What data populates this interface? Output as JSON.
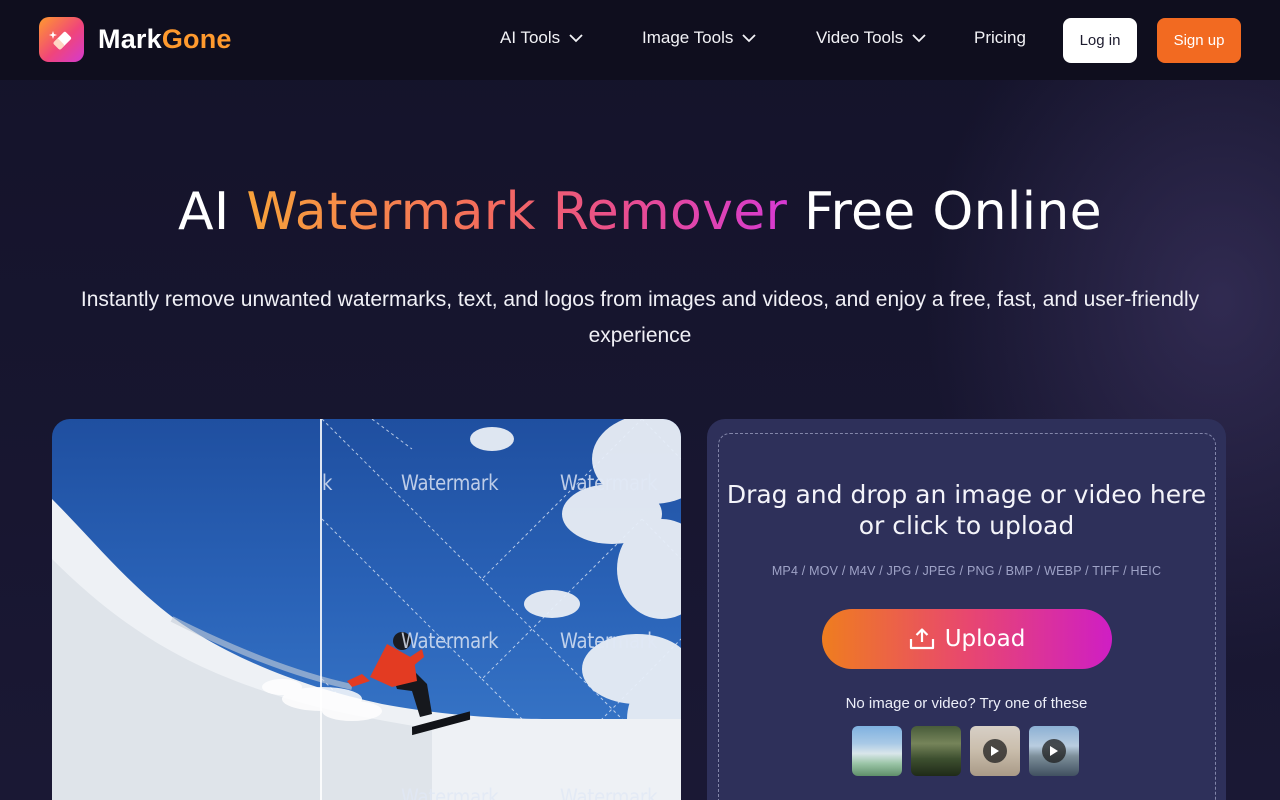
{
  "brand": {
    "name_part1": "Mark",
    "name_part2": "Gone",
    "logo_icon": "eraser-sparkle-icon"
  },
  "nav": {
    "ai_tools": "AI Tools",
    "image_tools": "Image Tools",
    "video_tools": "Video Tools",
    "pricing": "Pricing",
    "login": "Log in",
    "signup": "Sign up"
  },
  "hero": {
    "title_part1": "AI ",
    "title_highlight": "Watermark Remover",
    "title_part2": " Free Online",
    "subtitle": "Instantly remove unwanted watermarks, text, and logos from images and videos, and enjoy a free, fast, and user-friendly experience"
  },
  "preview": {
    "watermark_text": "Watermark",
    "watermark_partial": "k"
  },
  "upload": {
    "drop_title_line1": "Drag and drop an image or video here",
    "drop_title_line2": "or click to upload",
    "formats": "MP4 / MOV / M4V / JPG / JPEG / PNG / BMP / WEBP / TIFF / HEIC",
    "button_label": "Upload",
    "samples_label": "No image or video? Try one of these"
  },
  "colors": {
    "accent_orange": "#f26a21",
    "brand_orange": "#ff9a2e",
    "panel_bg": "#2e305a",
    "nav_bg": "#0f0e1e"
  }
}
